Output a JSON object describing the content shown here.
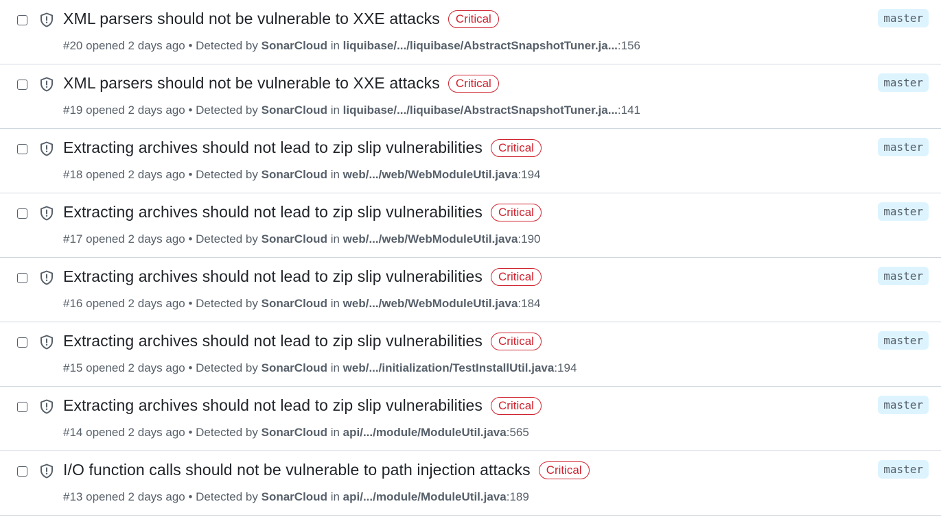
{
  "alerts": [
    {
      "title": "XML parsers should not be vulnerable to XXE attacks",
      "severity": "Critical",
      "number": "#20",
      "opened": "opened 2 days ago",
      "bullet": "•",
      "detected_by_prefix": "Detected by",
      "tool": "SonarCloud",
      "in_label": "in",
      "path": "liquibase/.../liquibase/AbstractSnapshotTuner.ja...",
      "line": ":156",
      "branch": "master"
    },
    {
      "title": "XML parsers should not be vulnerable to XXE attacks",
      "severity": "Critical",
      "number": "#19",
      "opened": "opened 2 days ago",
      "bullet": "•",
      "detected_by_prefix": "Detected by",
      "tool": "SonarCloud",
      "in_label": "in",
      "path": "liquibase/.../liquibase/AbstractSnapshotTuner.ja...",
      "line": ":141",
      "branch": "master"
    },
    {
      "title": "Extracting archives should not lead to zip slip vulnerabilities",
      "severity": "Critical",
      "number": "#18",
      "opened": "opened 2 days ago",
      "bullet": "•",
      "detected_by_prefix": "Detected by",
      "tool": "SonarCloud",
      "in_label": "in",
      "path": "web/.../web/WebModuleUtil.java",
      "line": ":194",
      "branch": "master"
    },
    {
      "title": "Extracting archives should not lead to zip slip vulnerabilities",
      "severity": "Critical",
      "number": "#17",
      "opened": "opened 2 days ago",
      "bullet": "•",
      "detected_by_prefix": "Detected by",
      "tool": "SonarCloud",
      "in_label": "in",
      "path": "web/.../web/WebModuleUtil.java",
      "line": ":190",
      "branch": "master"
    },
    {
      "title": "Extracting archives should not lead to zip slip vulnerabilities",
      "severity": "Critical",
      "number": "#16",
      "opened": "opened 2 days ago",
      "bullet": "•",
      "detected_by_prefix": "Detected by",
      "tool": "SonarCloud",
      "in_label": "in",
      "path": "web/.../web/WebModuleUtil.java",
      "line": ":184",
      "branch": "master"
    },
    {
      "title": "Extracting archives should not lead to zip slip vulnerabilities",
      "severity": "Critical",
      "number": "#15",
      "opened": "opened 2 days ago",
      "bullet": "•",
      "detected_by_prefix": "Detected by",
      "tool": "SonarCloud",
      "in_label": "in",
      "path": "web/.../initialization/TestInstallUtil.java",
      "line": ":194",
      "branch": "master"
    },
    {
      "title": "Extracting archives should not lead to zip slip vulnerabilities",
      "severity": "Critical",
      "number": "#14",
      "opened": "opened 2 days ago",
      "bullet": "•",
      "detected_by_prefix": "Detected by",
      "tool": "SonarCloud",
      "in_label": "in",
      "path": "api/.../module/ModuleUtil.java",
      "line": ":565",
      "branch": "master"
    },
    {
      "title": "I/O function calls should not be vulnerable to path injection attacks",
      "severity": "Critical",
      "number": "#13",
      "opened": "opened 2 days ago",
      "bullet": "•",
      "detected_by_prefix": "Detected by",
      "tool": "SonarCloud",
      "in_label": "in",
      "path": "api/.../module/ModuleUtil.java",
      "line": ":189",
      "branch": "master"
    }
  ],
  "icons": {
    "row_icon": "shield-alert-icon"
  },
  "colors": {
    "critical": "#cf222e",
    "branch_bg": "#ddf4ff",
    "muted": "#57606a"
  }
}
